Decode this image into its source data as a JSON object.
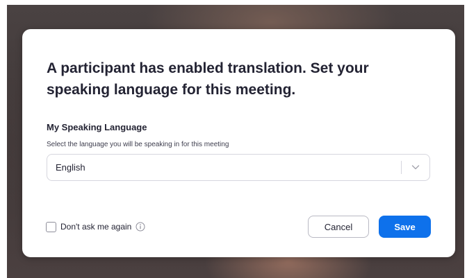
{
  "dialog": {
    "title": "A participant has enabled translation. Set your speaking language for this meeting.",
    "section_label": "My Speaking Language",
    "section_description": "Select the language you will be speaking in for this meeting",
    "language_select": {
      "selected_value": "English",
      "icon": "chevron-down-icon"
    },
    "dont_ask": {
      "label": "Don't ask me again",
      "checked": false,
      "icon": "info-icon"
    },
    "buttons": {
      "cancel_label": "Cancel",
      "save_label": "Save"
    }
  },
  "colors": {
    "primary": "#0e71eb",
    "text": "#232333",
    "border": "#d6d6de"
  }
}
